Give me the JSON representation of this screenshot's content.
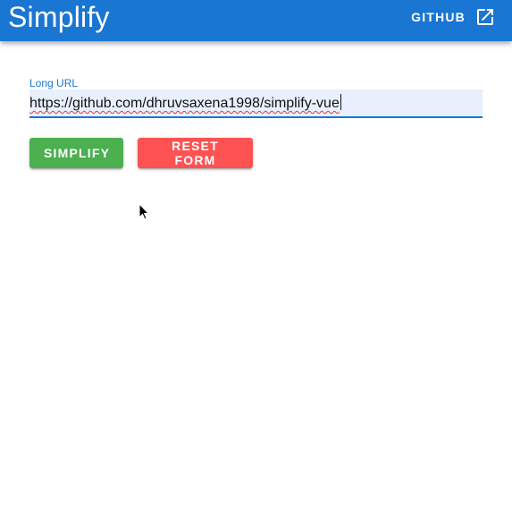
{
  "app": {
    "title": "Simplify",
    "colors": {
      "primary": "#1976d2",
      "simplify_button": "#4caf50",
      "reset_button": "#ff5252",
      "input_fill": "#e8f0fe"
    }
  },
  "header": {
    "github_label": "GITHUB",
    "github_icon": "open-in-new-icon"
  },
  "form": {
    "long_url_label": "Long URL",
    "long_url_value": "https://github.com/dhruvsaxena1998/simplify-vue",
    "simplify_label": "SIMPLIFY",
    "reset_label": "RESET FORM"
  }
}
